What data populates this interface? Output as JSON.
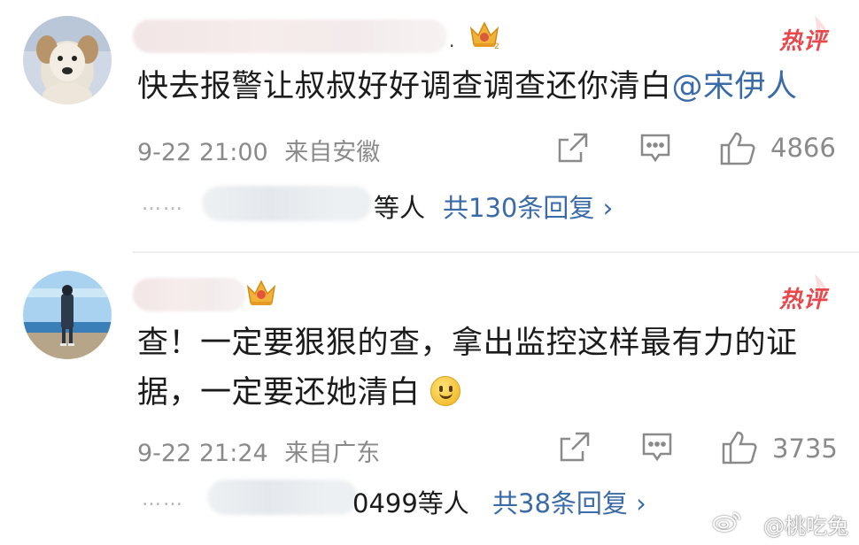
{
  "comments": [
    {
      "content": "快去报警让叔叔好好调查调查还你清白",
      "mention": "@宋伊人",
      "dot": ".",
      "hot_label": "热评",
      "time": "9-22 21:00",
      "location": "来自安徽",
      "like_count": "4866",
      "reply_names_suffix": "等人",
      "reply_count": "共130条回复 ›"
    },
    {
      "content_line1": "查！一定要狠狠的查，拿出监控这样最有力的证",
      "content_line2": "据，一定要还她清白",
      "hot_label": "热评",
      "time": "9-22 21:24",
      "location": "来自广东",
      "like_count": "3735",
      "reply_names_suffix": "0499等人",
      "reply_count": "共38条回复 ›"
    }
  ],
  "ellipsis": "……",
  "watermark": "@桃吃兔",
  "icons": [
    "share-icon",
    "comment-icon",
    "like-icon",
    "crown-badge-icon",
    "smile-emoji-icon",
    "weibo-logo-icon"
  ],
  "colors": {
    "link": "#3a6aa8",
    "hot": "#e8474b",
    "meta": "#8a8a8a"
  }
}
